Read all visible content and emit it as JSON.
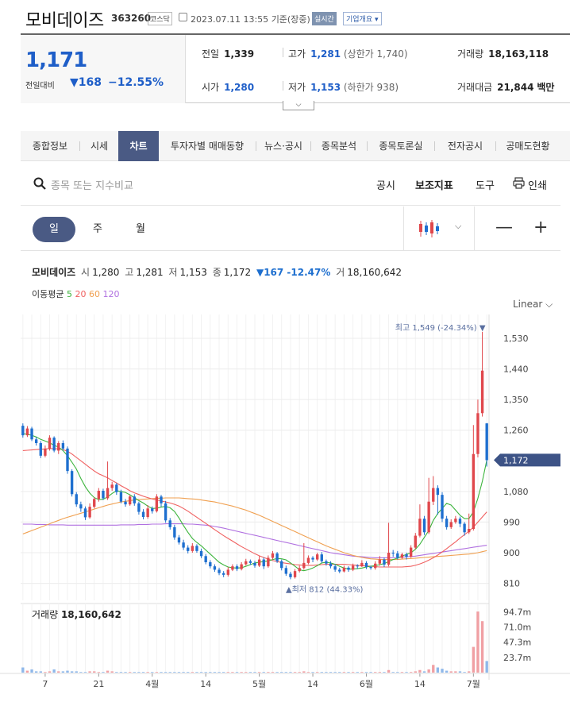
{
  "header": {
    "name": "모비데이즈",
    "code": "363260",
    "market": "코스닥",
    "datetime": "2023.07.11 13:55",
    "basis": "기준(장중)",
    "realtime": "실시간",
    "overview": "기업개요 ▾"
  },
  "summary": {
    "price": "1,171",
    "change_label": "전일대비",
    "change_arrow": "▼",
    "change": "168",
    "change_pct": "−12.55%",
    "prev_close_label": "전일",
    "prev_close": "1,339",
    "open_label": "시가",
    "open": "1,280",
    "high_label": "고가",
    "high": "1,281",
    "upper_limit": "(상한가 1,740)",
    "low_label": "저가",
    "low": "1,153",
    "lower_limit": "(하한가 938)",
    "volume_label": "거래량",
    "volume": "18,163,118",
    "amount_label": "거래대금",
    "amount": "21,844",
    "amount_unit": "백만"
  },
  "tabs": [
    "종합정보",
    "시세",
    "차트",
    "투자자별 매매동향",
    "뉴스·공시",
    "종목분석",
    "종목토론실",
    "전자공시",
    "공매도현황"
  ],
  "active_tab": "차트",
  "toolbar": {
    "search_placeholder": "종목 또는 지수비교",
    "notice": "공시",
    "indicator": "보조지표",
    "tools": "도구",
    "print": "인쇄"
  },
  "period": {
    "day": "일",
    "week": "주",
    "month": "월",
    "active": "일",
    "minus": "—",
    "plus": "+"
  },
  "legend": {
    "name": "모비데이즈",
    "open_label": "시",
    "open": "1,280",
    "high_label": "고",
    "high": "1,281",
    "low_label": "저",
    "low": "1,153",
    "close_label": "종",
    "close": "1,172",
    "change": "▼167 -12.47%",
    "vol_label": "거",
    "vol": "18,160,642"
  },
  "ma": {
    "label": "이동평균",
    "periods": [
      {
        "n": "5",
        "color": "#3cb43c"
      },
      {
        "n": "20",
        "color": "#f06060"
      },
      {
        "n": "60",
        "color": "#f0a050"
      },
      {
        "n": "120",
        "color": "#b070e0"
      }
    ]
  },
  "scale_label": "Linear ⌵",
  "volume_panel": {
    "label": "거래량",
    "value": "18,160,642",
    "ticks": [
      "94.7m",
      "71.0m",
      "47.3m",
      "23.7m"
    ]
  },
  "chart_data": {
    "type": "candlestick",
    "up_color": "#e0474c",
    "down_color": "#1e6fcf",
    "ylim": [
      760,
      1600
    ],
    "y_ticks": [
      "1,530",
      "1,440",
      "1,350",
      "1,260",
      "1,080",
      "990",
      "900",
      "810"
    ],
    "y_tick_values": [
      1530,
      1440,
      1350,
      1260,
      1080,
      990,
      900,
      810
    ],
    "current_price": "1,172",
    "current_value": 1172,
    "x_ticks": [
      "7",
      "21",
      "4월",
      "14",
      "5월",
      "14",
      "6월",
      "14",
      "7월"
    ],
    "x_tick_index": [
      5,
      17,
      29,
      41,
      53,
      65,
      77,
      89,
      101
    ],
    "high_annotation": "최고 1,549 (-24.34%) ▼",
    "low_annotation": "▲최저 812 (44.33%)",
    "candles": [
      [
        1273,
        1245,
        1280,
        1238
      ],
      [
        1245,
        1265,
        1272,
        1240
      ],
      [
        1265,
        1233,
        1270,
        1228
      ],
      [
        1233,
        1222,
        1240,
        1215
      ],
      [
        1222,
        1185,
        1228,
        1178
      ],
      [
        1185,
        1205,
        1215,
        1180
      ],
      [
        1205,
        1238,
        1245,
        1200
      ],
      [
        1238,
        1200,
        1242,
        1195
      ],
      [
        1200,
        1222,
        1228,
        1190
      ],
      [
        1222,
        1206,
        1230,
        1200
      ],
      [
        1206,
        1140,
        1212,
        1132
      ],
      [
        1140,
        1072,
        1145,
        1065
      ],
      [
        1072,
        1042,
        1078,
        1035
      ],
      [
        1042,
        1030,
        1050,
        1020
      ],
      [
        1030,
        1004,
        1036,
        996
      ],
      [
        1004,
        1035,
        1045,
        1000
      ],
      [
        1035,
        1058,
        1062,
        1030
      ],
      [
        1058,
        1082,
        1090,
        1050
      ],
      [
        1082,
        1060,
        1088,
        1055
      ],
      [
        1060,
        1090,
        1168,
        1055
      ],
      [
        1090,
        1100,
        1108,
        1082
      ],
      [
        1100,
        1078,
        1105,
        1070
      ],
      [
        1078,
        1050,
        1085,
        1045
      ],
      [
        1050,
        1042,
        1058,
        1035
      ],
      [
        1042,
        1065,
        1070,
        1038
      ],
      [
        1065,
        1045,
        1072,
        1038
      ],
      [
        1045,
        1020,
        1050,
        1012
      ],
      [
        1020,
        1005,
        1028,
        998
      ],
      [
        1005,
        1030,
        1040,
        1000
      ],
      [
        1030,
        1022,
        1036,
        1015
      ],
      [
        1022,
        1065,
        1072,
        1018
      ],
      [
        1065,
        1045,
        1070,
        1035
      ],
      [
        1045,
        995,
        1052,
        988
      ],
      [
        995,
        975,
        1002,
        968
      ],
      [
        975,
        945,
        982,
        938
      ],
      [
        945,
        930,
        952,
        924
      ],
      [
        930,
        915,
        938,
        908
      ],
      [
        915,
        905,
        922,
        898
      ],
      [
        905,
        920,
        928,
        900
      ],
      [
        920,
        905,
        925,
        900
      ],
      [
        905,
        890,
        912,
        884
      ],
      [
        890,
        872,
        896,
        866
      ],
      [
        872,
        860,
        878,
        854
      ],
      [
        860,
        850,
        866,
        844
      ],
      [
        850,
        840,
        856,
        834
      ],
      [
        840,
        835,
        846,
        828
      ],
      [
        835,
        850,
        858,
        830
      ],
      [
        850,
        860,
        866,
        846
      ],
      [
        860,
        852,
        866,
        846
      ],
      [
        852,
        866,
        872,
        848
      ],
      [
        866,
        875,
        882,
        862
      ],
      [
        875,
        870,
        880,
        864
      ],
      [
        870,
        862,
        876,
        856
      ],
      [
        862,
        880,
        890,
        858
      ],
      [
        880,
        860,
        886,
        852
      ],
      [
        860,
        885,
        892,
        856
      ],
      [
        885,
        898,
        905,
        880
      ],
      [
        898,
        875,
        902,
        870
      ],
      [
        875,
        855,
        880,
        848
      ],
      [
        855,
        838,
        862,
        832
      ],
      [
        838,
        828,
        844,
        822
      ],
      [
        828,
        846,
        852,
        824
      ],
      [
        846,
        855,
        862,
        842
      ],
      [
        855,
        870,
        928,
        850
      ],
      [
        870,
        885,
        892,
        866
      ],
      [
        885,
        880,
        890,
        872
      ],
      [
        880,
        895,
        900,
        876
      ],
      [
        895,
        875,
        902,
        870
      ],
      [
        875,
        868,
        880,
        862
      ],
      [
        868,
        860,
        875,
        854
      ],
      [
        860,
        850,
        866,
        844
      ],
      [
        850,
        845,
        856,
        840
      ],
      [
        845,
        856,
        862,
        842
      ],
      [
        856,
        850,
        860,
        844
      ],
      [
        850,
        862,
        868,
        846
      ],
      [
        862,
        860,
        866,
        852
      ],
      [
        860,
        870,
        878,
        858
      ],
      [
        870,
        858,
        875,
        852
      ],
      [
        858,
        855,
        862,
        850
      ],
      [
        855,
        868,
        875,
        850
      ],
      [
        868,
        880,
        890,
        862
      ],
      [
        880,
        865,
        886,
        858
      ],
      [
        865,
        900,
        988,
        860
      ],
      [
        900,
        898,
        908,
        888
      ],
      [
        898,
        885,
        905,
        880
      ],
      [
        885,
        895,
        900,
        882
      ],
      [
        895,
        888,
        900,
        880
      ],
      [
        888,
        915,
        922,
        885
      ],
      [
        915,
        950,
        958,
        910
      ],
      [
        950,
        1000,
        1042,
        945
      ],
      [
        1000,
        960,
        1008,
        952
      ],
      [
        960,
        1050,
        1120,
        955
      ],
      [
        1050,
        1090,
        1125,
        1040
      ],
      [
        1090,
        1070,
        1098,
        1012
      ],
      [
        1070,
        1000,
        1078,
        990
      ],
      [
        1000,
        975,
        1008,
        968
      ],
      [
        975,
        990,
        998,
        970
      ],
      [
        990,
        1000,
        1008,
        985
      ],
      [
        1000,
        985,
        1006,
        975
      ],
      [
        985,
        960,
        990,
        950
      ],
      [
        960,
        970,
        1015,
        955
      ],
      [
        970,
        1190,
        1275,
        965
      ],
      [
        1190,
        1310,
        1350,
        1180
      ],
      [
        1310,
        1435,
        1549,
        1300
      ],
      [
        1280,
        1172,
        1281,
        1153
      ]
    ],
    "ma5": [
      1250,
      1248,
      1245,
      1240,
      1233,
      1228,
      1223,
      1216,
      1210,
      1200,
      1185,
      1166,
      1146,
      1118,
      1094,
      1075,
      1062,
      1056,
      1057,
      1064,
      1074,
      1082,
      1080,
      1077,
      1070,
      1062,
      1053,
      1046,
      1037,
      1030,
      1031,
      1034,
      1036,
      1032,
      1021,
      1002,
      980,
      960,
      942,
      930,
      920,
      908,
      896,
      884,
      872,
      864,
      858,
      856,
      855,
      856,
      860,
      865,
      870,
      872,
      874,
      876,
      880,
      883,
      882,
      879,
      870,
      860,
      850,
      847,
      850,
      855,
      862,
      870,
      872,
      870,
      866,
      860,
      855,
      852,
      852,
      853,
      855,
      858,
      860,
      862,
      865,
      868,
      874,
      880,
      884,
      890,
      895,
      900,
      910,
      925,
      945,
      965,
      995,
      1015,
      1030,
      1045,
      1040,
      1025,
      1010,
      1000,
      1000,
      1020,
      1060,
      1110,
      1172
    ],
    "ma20": [
      1200,
      1201,
      1202,
      1203,
      1204,
      1205,
      1206,
      1206,
      1205,
      1203,
      1198,
      1190,
      1180,
      1170,
      1160,
      1150,
      1140,
      1132,
      1126,
      1120,
      1112,
      1105,
      1097,
      1090,
      1082,
      1076,
      1071,
      1066,
      1062,
      1058,
      1055,
      1052,
      1049,
      1046,
      1042,
      1037,
      1030,
      1022,
      1013,
      1004,
      995,
      986,
      977,
      968,
      959,
      950,
      942,
      934,
      926,
      918,
      911,
      904,
      897,
      891,
      886,
      881,
      877,
      874,
      871,
      869,
      867,
      865,
      864,
      863,
      863,
      863,
      864,
      865,
      866,
      866,
      866,
      866,
      866,
      865,
      864,
      863,
      862,
      861,
      860,
      859,
      858,
      858,
      858,
      858,
      858,
      858,
      859,
      860,
      863,
      867,
      872,
      878,
      885,
      893,
      902,
      912,
      922,
      932,
      943,
      953,
      963,
      975,
      990,
      1005,
      1020
    ],
    "ma60": [
      955,
      960,
      965,
      970,
      975,
      980,
      985,
      990,
      995,
      1000,
      1004,
      1008,
      1012,
      1016,
      1020,
      1024,
      1028,
      1032,
      1036,
      1040,
      1043,
      1046,
      1049,
      1051,
      1053,
      1055,
      1056,
      1057,
      1058,
      1059,
      1060,
      1060,
      1061,
      1061,
      1061,
      1061,
      1060,
      1059,
      1058,
      1057,
      1055,
      1053,
      1051,
      1049,
      1046,
      1043,
      1040,
      1037,
      1033,
      1029,
      1025,
      1020,
      1015,
      1010,
      1004,
      998,
      992,
      986,
      980,
      974,
      968,
      962,
      956,
      950,
      944,
      938,
      932,
      926,
      920,
      915,
      910,
      905,
      900,
      896,
      892,
      889,
      886,
      884,
      882,
      881,
      880,
      880,
      880,
      880,
      880,
      881,
      882,
      883,
      884,
      885,
      886,
      887,
      888,
      889,
      890,
      891,
      892,
      893,
      894,
      895,
      896,
      898,
      900,
      903,
      906
    ],
    "ma120": [
      984,
      984,
      984,
      983,
      983,
      983,
      982,
      982,
      982,
      982,
      981,
      981,
      981,
      981,
      981,
      981,
      981,
      981,
      981,
      981,
      981,
      981,
      982,
      982,
      982,
      982,
      983,
      983,
      983,
      984,
      984,
      984,
      985,
      985,
      985,
      985,
      985,
      984,
      984,
      983,
      982,
      981,
      979,
      977,
      975,
      972,
      969,
      966,
      963,
      960,
      957,
      954,
      951,
      948,
      945,
      942,
      939,
      936,
      933,
      930,
      927,
      924,
      921,
      918,
      915,
      912,
      909,
      906,
      903,
      900,
      898,
      896,
      894,
      892,
      890,
      889,
      888,
      887,
      886,
      885,
      885,
      885,
      885,
      885,
      886,
      887,
      888,
      889,
      890,
      892,
      894,
      896,
      898,
      900,
      902,
      904,
      906,
      908,
      910,
      912,
      914,
      916,
      918,
      920,
      922
    ],
    "volume": [
      8,
      3,
      5,
      2,
      2,
      1,
      2,
      5,
      2,
      2,
      3,
      2,
      2,
      1,
      1,
      2,
      2,
      1,
      1,
      3,
      2,
      1,
      1,
      1,
      1,
      1,
      1,
      1,
      1,
      1,
      1,
      1,
      1,
      1,
      1,
      1,
      1,
      1,
      1,
      1,
      1,
      1,
      1,
      1,
      1,
      1,
      1,
      1,
      1,
      1,
      1,
      1,
      1,
      1,
      1,
      1,
      1,
      1,
      1,
      1,
      1,
      1,
      1,
      2,
      1,
      1,
      1,
      1,
      1,
      1,
      1,
      1,
      1,
      1,
      1,
      1,
      1,
      1,
      1,
      1,
      1,
      1,
      4,
      1,
      1,
      1,
      1,
      1,
      2,
      4,
      2,
      5,
      12,
      8,
      6,
      3,
      2,
      2,
      2,
      1,
      2,
      40,
      95,
      80,
      18
    ]
  }
}
